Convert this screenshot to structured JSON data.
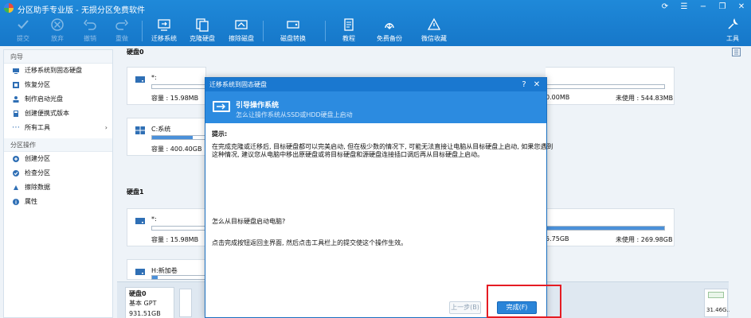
{
  "app": {
    "title": "分区助手专业版 - 无损分区免费软件"
  },
  "toolbar": {
    "items": [
      {
        "label": "提交",
        "icon": "check-icon",
        "enabled": false
      },
      {
        "label": "放弃",
        "icon": "discard-icon",
        "enabled": false
      },
      {
        "label": "撤销",
        "icon": "undo-icon",
        "enabled": false
      },
      {
        "label": "重做",
        "icon": "redo-icon",
        "enabled": false
      },
      {
        "label": "迁移系统",
        "icon": "migrate-os-icon",
        "enabled": true
      },
      {
        "label": "克隆硬盘",
        "icon": "clone-disk-icon",
        "enabled": true
      },
      {
        "label": "擦除磁盘",
        "icon": "wipe-disk-icon",
        "enabled": true
      },
      {
        "label": "磁盘转换",
        "icon": "disk-convert-icon",
        "enabled": true
      },
      {
        "label": "教程",
        "icon": "tutorial-icon",
        "enabled": true
      },
      {
        "label": "免费备份",
        "icon": "free-backup-icon",
        "enabled": true
      },
      {
        "label": "微信收藏",
        "icon": "wechat-icon",
        "enabled": true
      }
    ],
    "tools_label": "工具"
  },
  "sidebar": {
    "wizard_header": "向导",
    "wizard_items": [
      {
        "label": "迁移系统到固态硬盘"
      },
      {
        "label": "恢复分区"
      },
      {
        "label": "制作启动光盘"
      },
      {
        "label": "创建便携式版本"
      },
      {
        "label": "所有工具"
      }
    ],
    "ops_header": "分区操作",
    "ops_items": [
      {
        "label": "创建分区"
      },
      {
        "label": "检查分区"
      },
      {
        "label": "擦除数据"
      },
      {
        "label": "属性"
      }
    ]
  },
  "disks": {
    "disk0_label": "硬盘0",
    "disk1_label": "硬盘1",
    "disk0": {
      "p1": {
        "name": "*:",
        "capacity": "容量 : 15.98MB"
      },
      "p2": {
        "capacity_fragment": "0.00MB",
        "free": "未使用 : 544.83MB"
      },
      "p3": {
        "name": "C:系统",
        "capacity": "容量 : 400.40GB"
      }
    },
    "disk1": {
      "p1": {
        "name": "*:",
        "capacity": "容量 : 15.98MB"
      },
      "p2": {
        "capacity_fragment": "5.75GB",
        "free": "未使用 : 269.98GB"
      },
      "p3": {
        "name": "H:新加卷"
      }
    },
    "bottom": {
      "disk_name": "硬盘0",
      "disk_type": "基本 GPT",
      "disk_size_partial": "931.51GB",
      "right_size": "31.46G..."
    }
  },
  "modal": {
    "title": "迁移系统到固态硬盘",
    "heading": "引导操作系统",
    "subheading": "怎么让操作系统从SSD或HDD硬盘上启动",
    "tip_label": "提示:",
    "tip_line1": "在完成克隆或迁移后, 目标硬盘都可以完美启动, 但在极少数的情况下, 可能无法直接让电脑从目标硬盘上启动, 如果您遇到",
    "tip_line2": "这种情况, 建议您从电脑中移出原硬盘或将目标硬盘和源硬盘连接插口调后再从目标硬盘上启动。",
    "howto_label": "怎么从目标硬盘启动电脑?",
    "howto_text": "点击完成按钮返回主界面, 然后点击工具栏上的提交使这个操作生效。",
    "prev_button": "上一步(B)",
    "finish_button": "完成(F)"
  },
  "colors": {
    "toolbar_bg": "#1a7fd4",
    "accent": "#2c8be0",
    "highlight_box": "#e51c23"
  }
}
